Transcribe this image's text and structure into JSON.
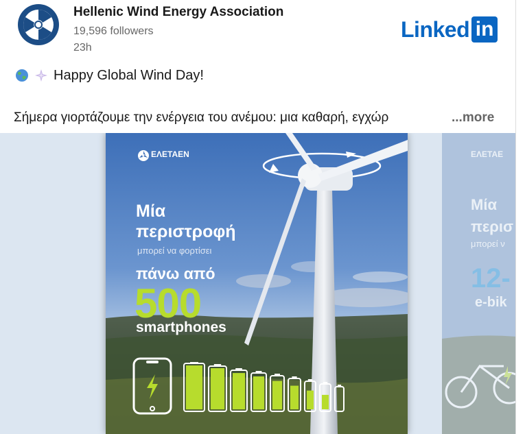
{
  "post": {
    "org_name": "Hellenic Wind Energy Association",
    "followers": "19,596 followers",
    "time": "23h",
    "platform_logo": {
      "word": "Linked",
      "box": "in"
    },
    "line1": "Happy Global Wind Day!",
    "line2": "Σήμερα γιορτάζουμε την ενέργεια του ανέμου: μια καθαρή, εγχώρ",
    "more_label": "...more",
    "emojis": [
      "globe-icon",
      "sparkle-icon"
    ]
  },
  "slide": {
    "brand": "ΕΛΕΤΑΕΝ",
    "line_a": "Μία",
    "line_b": "περιστροφή",
    "line_c": "μπορεί να φορτίσει",
    "line_d": "πάνω από",
    "number": "500",
    "line_e": "smartphones",
    "battery_fill_levels": [
      1.0,
      1.0,
      0.98,
      0.96,
      0.9,
      0.82,
      0.72,
      0.62,
      0.0,
      0.0
    ]
  },
  "next_slide": {
    "brand": "ΕΛΕΤΑΕ",
    "line_a": "Μία",
    "line_b": "περισ",
    "line_c": "μπορεί ν",
    "number": "12-",
    "line_e": "e-bik"
  },
  "colors": {
    "linkedin_blue": "#0a66c2",
    "accent_green": "#b7dc2d",
    "sky": "#5d88c8"
  }
}
